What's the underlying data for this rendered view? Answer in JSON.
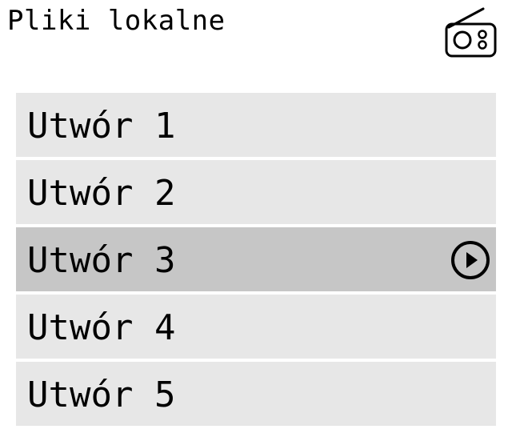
{
  "header": {
    "title": "Pliki lokalne",
    "radio_icon": "radio-icon"
  },
  "tracks": {
    "selected_index": 2,
    "items": [
      {
        "label": "Utwór 1"
      },
      {
        "label": "Utwór 2"
      },
      {
        "label": "Utwór 3",
        "playing_icon": "play-circle-icon"
      },
      {
        "label": "Utwór 4"
      },
      {
        "label": "Utwór 5"
      }
    ]
  },
  "colors": {
    "item_background": "#e7e7e7",
    "selected_background": "#c6c6c6",
    "text": "#000000"
  }
}
